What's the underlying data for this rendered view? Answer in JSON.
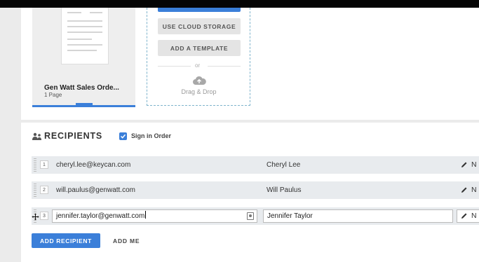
{
  "document": {
    "title": "Gen Watt Sales Orde...",
    "pages": "1 Page"
  },
  "upload": {
    "cloud_label": "USE CLOUD STORAGE",
    "template_label": "ADD A TEMPLATE",
    "or_label": "or",
    "drag_label": "Drag & Drop"
  },
  "recipients": {
    "title": "RECIPIENTS",
    "sign_in_order_label": "Sign in Order",
    "sign_in_order_checked": true,
    "rows": [
      {
        "number": "1",
        "email": "cheryl.lee@keycan.com",
        "name": "Cheryl Lee",
        "action_label": "N"
      },
      {
        "number": "2",
        "email": "will.paulus@genwatt.com",
        "name": "Will Paulus",
        "action_label": "N"
      },
      {
        "number": "3",
        "email": "jennifer.taylor@genwatt.com",
        "name": "Jennifer Taylor",
        "action_label": "N"
      }
    ],
    "add_recipient_label": "ADD RECIPIENT",
    "add_me_label": "ADD ME"
  },
  "colors": {
    "accent": "#3b7fd9",
    "row_background": "#e8ebee",
    "page_background": "#ebebeb"
  },
  "icons": {
    "recipients": "recipients-icon",
    "cloud": "cloud-upload-icon",
    "edit": "pencil-icon",
    "contact": "contact-book-icon",
    "cursor": "move-cursor-icon"
  }
}
